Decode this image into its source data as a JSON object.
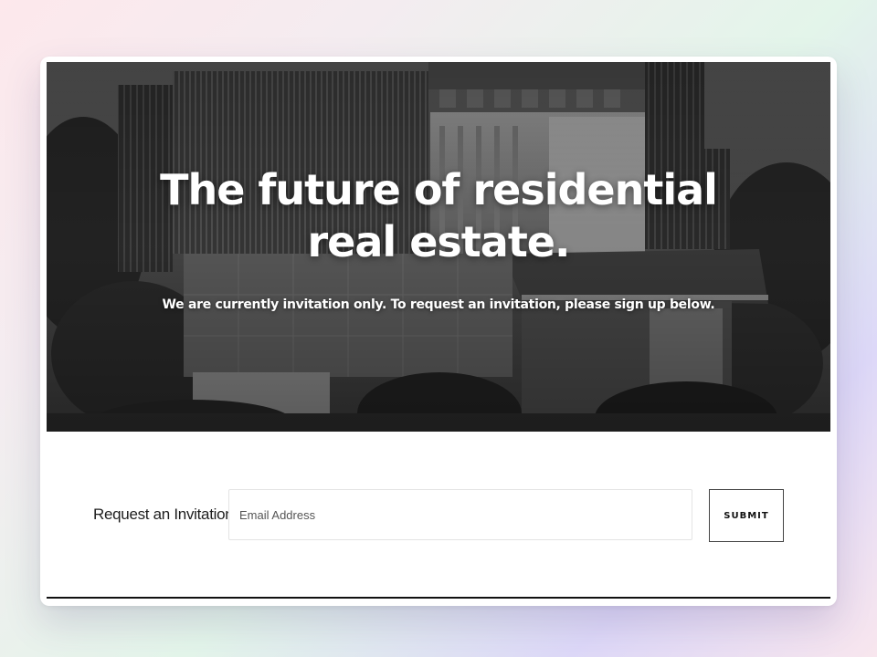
{
  "hero": {
    "title_line1": "The future of residential",
    "title_line2": "real estate.",
    "subtitle": "We are currently invitation only. To request an invitation, please sign up below."
  },
  "form": {
    "label": "Request an Invitation",
    "email_placeholder": "Email Address",
    "email_value": "",
    "submit_label": "SUBMIT"
  },
  "colors": {
    "card_background": "#ffffff",
    "button_border": "#444444",
    "bottom_rule": "#111111"
  }
}
